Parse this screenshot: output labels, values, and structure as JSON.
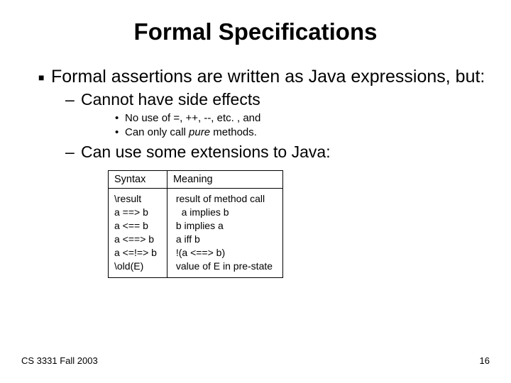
{
  "title": "Formal Specifications",
  "bullet1": "Formal assertions are written as Java expressions, but:",
  "sub1": "Cannot have side effects",
  "sub1_a": "No use of =, ++, --, etc. , and",
  "sub1_b_pre": "Can only call ",
  "sub1_b_em": "pure",
  "sub1_b_post": " methods.",
  "sub2": "Can use some extensions to Java:",
  "table": {
    "head_syntax": "Syntax",
    "head_meaning": "Meaning",
    "syntax_col": "\\result\na ==> b\na <== b\na <==> b\na <=!=> b\n\\old(E)",
    "meaning_col": " result of method call\n   a implies b\n b implies a\n a iff b\n !(a <==> b)\n value of E in pre-state"
  },
  "footer_left": "CS 3331 Fall 2003",
  "footer_right": "16"
}
